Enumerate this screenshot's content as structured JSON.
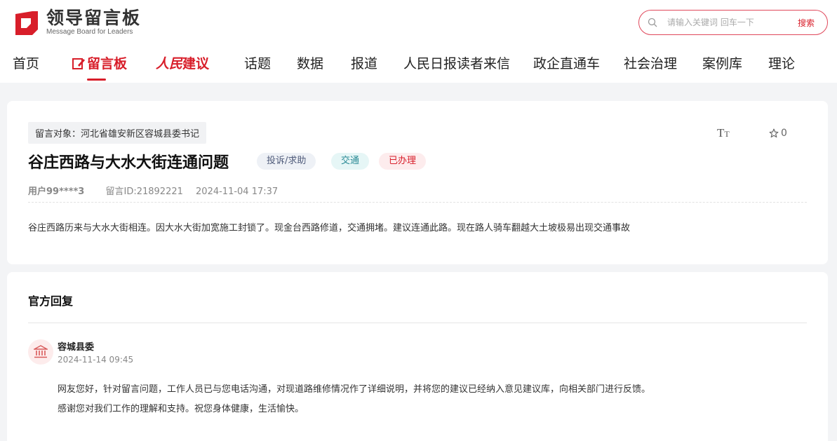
{
  "header": {
    "logo_cn": "领导留言板",
    "logo_en": "Message Board for Leaders",
    "search_placeholder": "请输入关键词 回车一下",
    "search_button": "搜索"
  },
  "nav": {
    "items": [
      "首页",
      "留言板",
      "人民建议",
      "话题",
      "数据",
      "报道",
      "人民日报读者来信",
      "政企直通车",
      "社会治理",
      "案例库",
      "理论"
    ],
    "brand_part1": "人民",
    "brand_part2": "建议"
  },
  "message": {
    "target": "留言对象：河北省雄安新区容城县委书记",
    "title": "谷庄西路与大水大街连通问题",
    "tags": {
      "type": "投诉/求助",
      "category": "交通",
      "status": "已办理"
    },
    "user": "用户99****3",
    "message_id": "留言ID:21892221",
    "datetime": "2024-11-04 17:37",
    "font_icon": "TT",
    "fav_count": "0",
    "content": "谷庄西路历来与大水大街相连。因大水大街加宽施工封锁了。现金台西路修道，交通拥堵。建议连通此路。现在路人骑车翻越大土坡极易出现交通事故"
  },
  "reply": {
    "section_title": "官方回复",
    "org": "容城县委",
    "time": "2024-11-14 09:45",
    "line1": "网友您好，针对留言问题，工作人员已与您电话沟通，对现道路维修情况作了详细说明，并将您的建议已经纳入意见建议库，向相关部门进行反馈。",
    "line2": "感谢您对我们工作的理解和支持。祝您身体健康，生活愉快。"
  },
  "colors": {
    "brand_red": "#d81e2a",
    "page_bg": "#f3f4f6"
  },
  "icons": {
    "logo": "logo-mark-icon",
    "search": "search-icon",
    "star": "star-icon",
    "bank": "government-building-icon"
  }
}
